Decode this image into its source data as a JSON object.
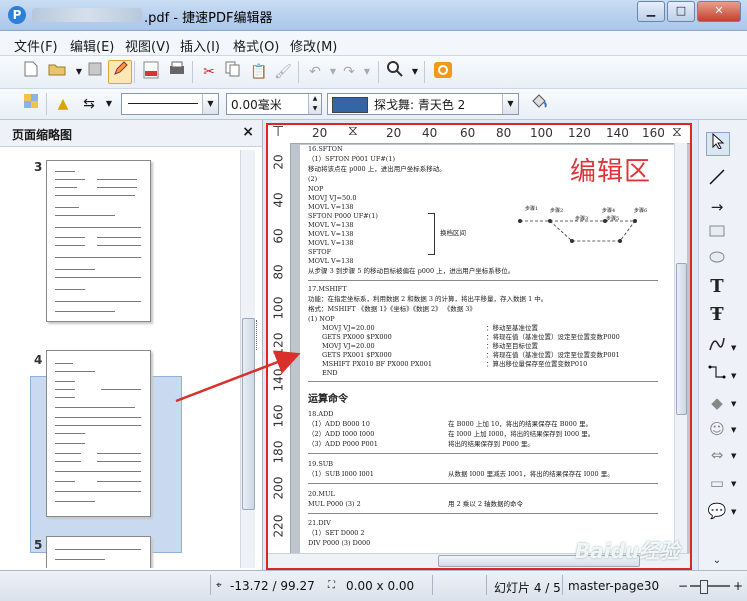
{
  "title": ".pdf - 捷速PDF编辑器",
  "window_buttons": {
    "minimize": "▁",
    "maximize": "□",
    "close": "✕"
  },
  "menu": [
    "文件(F)",
    "编辑(E)",
    "视图(V)",
    "插入(I)",
    "格式(O)",
    "修改(M)"
  ],
  "toolbar2": {
    "line_width_value": "0.00毫米",
    "fill_color_name": "探戈舞: 青天色 2",
    "fill_color_hex": "#3465a4"
  },
  "sidebar": {
    "title": "页面缩略图",
    "close_label": "×",
    "pages": [
      {
        "number": "3"
      },
      {
        "number": "4",
        "selected": true
      },
      {
        "number": "5"
      }
    ]
  },
  "editor": {
    "label": "编辑区",
    "hruler_ticks": [
      "20",
      "20",
      "40",
      "60",
      "80",
      "100",
      "120",
      "140",
      "160"
    ],
    "vruler_ticks": [
      "20",
      "40",
      "60",
      "80",
      "100",
      "120",
      "140",
      "160",
      "180",
      "200",
      "220"
    ],
    "page_lines": [
      "16.SFTON",
      "（1）SFTON P001 UF#(1)",
      "移动将该点在 p000 上，进出用户坐标系移动。",
      "(2)",
      "NOP",
      "MOVJ VJ=50.0",
      "MOVL V=138",
      "SFTON P000 UF#(1)",
      "MOVL V=138",
      "MOVL V=138",
      "MOVL V=138",
      "SFTOF",
      "MOVL V=138",
      "从步骤 3 到步骤 5 的移动目标被偏在 p000 上，进出用户坐标系移位。",
      "17.MSHIFT",
      "功能：在指定坐标系，利用数据 2 和数据 3 的计算，将出平移量，存入数据 1 中。",
      "格式：MSHIFT 《数据 1》《坐标》《数据 2》 《数据 3》",
      "(1)  NOP",
      "MOVJ VJ=20.00",
      "GETS PX000 $PX000",
      "MOVJ VJ=20.00",
      "GETS PX001 $PX000",
      "MSHIFT PX010 BF PX000 PX001",
      "END",
      "运算命令",
      "18.ADD",
      "（1）ADD  B000 10",
      "（2）ADD  I000 I000",
      "（3）ADD P000 P001",
      "19.SUB",
      "（1）SUB I000 I001",
      "20.MUL",
      "MUL P000 (3) 2",
      "21.DIV",
      "（1）SET D000 2",
      "DIV P000 (3) D000"
    ],
    "page_notes": [
      "：移动至基准位置",
      "：将现在值（基准位置）设定至位置变数P000",
      "：移动至目标位置",
      "：将现在值（基准位置）设定至位置变数P001",
      "：算出移位量保存至位置变数P010"
    ],
    "page_right_notes": [
      "在 B000 上加 10，将出的结果保存在 B000 里。",
      "在 I000 上加 I000，将出的结果保存到 I000 里。",
      "将出的结果保存到 P000 里。",
      "从数据 I000 里减去 I001，将出的结果保存在 I000 里。",
      "用 2 乘以 2 轴数据的命令"
    ],
    "diagram_label": "换档区间",
    "diagram_steps": [
      "步骤1",
      "步骤2",
      "步骤3",
      "步骤4",
      "步骤5",
      "步骤6"
    ]
  },
  "status": {
    "position": "-13.72 / 99.27",
    "size": "0.00 x 0.00",
    "slide": "幻灯片 4 / 5",
    "master": "master-page30",
    "zoom_minus": "−",
    "zoom_plus": "+"
  },
  "watermark": "Baidu经验",
  "colors": {
    "accent_red": "#e02323",
    "selection": "#c9daf0"
  }
}
